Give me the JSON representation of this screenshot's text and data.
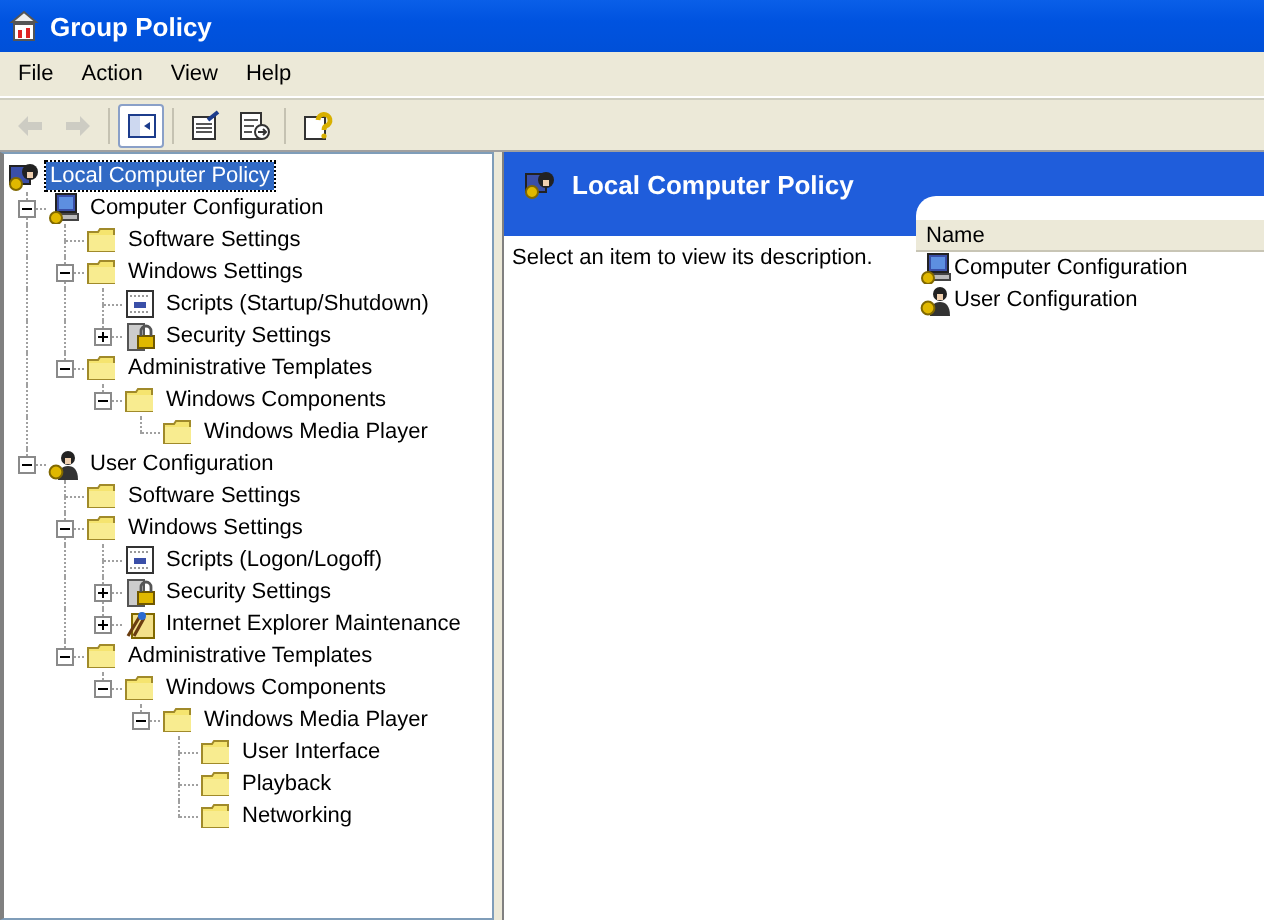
{
  "window": {
    "title": "Group Policy"
  },
  "menu": [
    "File",
    "Action",
    "View",
    "Help"
  ],
  "toolbar": [
    {
      "kind": "back",
      "disabled": true,
      "pressed": false
    },
    {
      "kind": "forward",
      "disabled": true,
      "pressed": false
    },
    {
      "kind": "tree",
      "disabled": false,
      "pressed": true
    },
    {
      "kind": "properties",
      "disabled": false,
      "pressed": false
    },
    {
      "kind": "export",
      "disabled": false,
      "pressed": false
    },
    {
      "kind": "help",
      "disabled": false,
      "pressed": false
    }
  ],
  "tree": {
    "label": "Local Computer Policy",
    "kind": "policy",
    "selected": true,
    "children": [
      {
        "label": "Computer Configuration",
        "kind": "computer",
        "expanded": true,
        "selected": false,
        "children": [
          {
            "label": "Software Settings",
            "kind": "folder",
            "selected": false
          },
          {
            "label": "Windows Settings",
            "kind": "folder",
            "expanded": true,
            "selected": false,
            "children": [
              {
                "label": "Scripts (Startup/Shutdown)",
                "kind": "scripts",
                "selected": false
              },
              {
                "label": "Security Settings",
                "kind": "security",
                "expanded": false,
                "selected": false
              }
            ]
          },
          {
            "label": "Administrative Templates",
            "kind": "folder",
            "expanded": true,
            "selected": false,
            "children": [
              {
                "label": "Windows Components",
                "kind": "folder",
                "expanded": true,
                "selected": false,
                "children": [
                  {
                    "label": "Windows Media Player",
                    "kind": "folder",
                    "selected": false
                  }
                ]
              }
            ]
          }
        ]
      },
      {
        "label": "User Configuration",
        "kind": "user",
        "expanded": true,
        "selected": false,
        "children": [
          {
            "label": "Software Settings",
            "kind": "folder",
            "selected": false
          },
          {
            "label": "Windows Settings",
            "kind": "folder",
            "expanded": true,
            "selected": false,
            "children": [
              {
                "label": "Scripts (Logon/Logoff)",
                "kind": "scripts",
                "selected": false
              },
              {
                "label": "Security Settings",
                "kind": "security",
                "expanded": false,
                "selected": false
              },
              {
                "label": "Internet Explorer Maintenance",
                "kind": "ie",
                "expanded": false,
                "selected": false
              }
            ]
          },
          {
            "label": "Administrative Templates",
            "kind": "folder",
            "expanded": true,
            "selected": false,
            "children": [
              {
                "label": "Windows Components",
                "kind": "folder",
                "expanded": true,
                "selected": false,
                "children": [
                  {
                    "label": "Windows Media Player",
                    "kind": "folder",
                    "expanded": true,
                    "selected": false,
                    "children": [
                      {
                        "label": "User Interface",
                        "kind": "folder",
                        "selected": false
                      },
                      {
                        "label": "Playback",
                        "kind": "folder",
                        "selected": false
                      },
                      {
                        "label": "Networking",
                        "kind": "folder",
                        "selected": false
                      }
                    ]
                  }
                ]
              }
            ]
          }
        ]
      }
    ]
  },
  "detail": {
    "title": "Local Computer Policy",
    "description": "Select an item to view its description.",
    "columns": [
      "Name"
    ],
    "items": [
      {
        "label": "Computer Configuration",
        "kind": "computer",
        "selected": false
      },
      {
        "label": "User Configuration",
        "kind": "user",
        "selected": false
      }
    ]
  }
}
